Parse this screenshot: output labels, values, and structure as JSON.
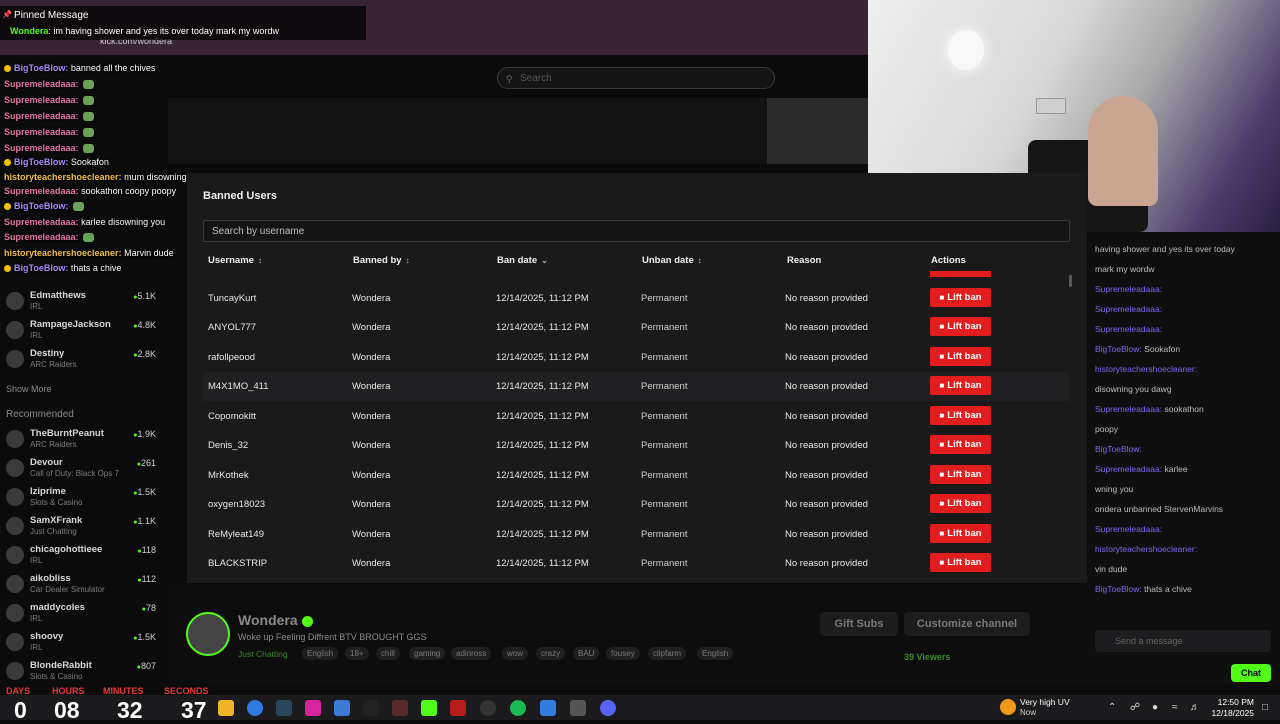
{
  "background": {
    "url": "kick.com/wondera",
    "search_placeholder": "Search"
  },
  "overlay_chat": {
    "pinned_title": "Pinned Message",
    "pinned_user": "Wondera",
    "pinned_text": "im having shower and yes its over today mark my wordw",
    "lines": [
      {
        "user": "BigToeBlow:",
        "text": "banned all the chives",
        "color": "#a78bfa",
        "badge": true
      },
      {
        "user": "Supremeleadaaa:",
        "text": "",
        "color": "#e879a6",
        "badge": false,
        "emote": true
      },
      {
        "user": "Supremeleadaaa:",
        "text": "",
        "color": "#e879a6",
        "badge": false,
        "emote": true
      },
      {
        "user": "Supremeleadaaa:",
        "text": "",
        "color": "#e879a6",
        "badge": false,
        "emote": true
      },
      {
        "user": "Supremeleadaaa:",
        "text": "",
        "color": "#e879a6",
        "badge": false,
        "emote": true
      },
      {
        "user": "Supremeleadaaa:",
        "text": "",
        "color": "#e879a6",
        "badge": false,
        "emote": true
      },
      {
        "user": "BigToeBlow:",
        "text": "Sookafon",
        "color": "#a78bfa",
        "badge": true
      },
      {
        "user": "historyteachershoecleaner:",
        "text": "mum disowning you dawg",
        "color": "#f0c040",
        "badge": false
      },
      {
        "user": "Supremeleadaaa:",
        "text": "sookathon coopy poopy",
        "color": "#e879a6",
        "badge": false
      },
      {
        "user": "BigToeBlow:",
        "text": "",
        "color": "#a78bfa",
        "badge": true,
        "emote": true
      },
      {
        "user": "Supremeleadaaa:",
        "text": "karlee disowning you",
        "color": "#e879a6",
        "badge": false
      },
      {
        "user": "Supremeleadaaa:",
        "text": "",
        "color": "#e879a6",
        "badge": false,
        "emote": true
      },
      {
        "user": "historyteachershoecleaner:",
        "text": "Marvin dude",
        "color": "#f0c040",
        "badge": false
      },
      {
        "user": "BigToeBlow:",
        "text": "thats a chive",
        "color": "#a78bfa",
        "badge": true
      }
    ]
  },
  "sidebar": {
    "recommended_label": "Recommended",
    "show_more": "Show More",
    "following": [
      {
        "name": "Edmatthews",
        "category": "IRL",
        "viewers": "5.1K"
      },
      {
        "name": "RampageJackson",
        "category": "IRL",
        "viewers": "4.8K"
      },
      {
        "name": "Destiny",
        "category": "ARC Raiders",
        "viewers": "2.8K"
      }
    ],
    "recommended": [
      {
        "name": "TheBurntPeanut",
        "category": "ARC Raiders",
        "viewers": "1.9K"
      },
      {
        "name": "Devour",
        "category": "Call of Duty: Black Ops 7",
        "viewers": "261"
      },
      {
        "name": "lziprime",
        "category": "Slots & Casino",
        "viewers": "1.5K"
      },
      {
        "name": "SamXFrank",
        "category": "Just Chatting",
        "viewers": "1.1K"
      },
      {
        "name": "chicagohottieee",
        "category": "IRL",
        "viewers": "118"
      },
      {
        "name": "aikobliss",
        "category": "Car Dealer Simulator",
        "viewers": "112"
      },
      {
        "name": "maddycoles",
        "category": "IRL",
        "viewers": "78"
      },
      {
        "name": "shoovy",
        "category": "IRL",
        "viewers": "1.5K"
      },
      {
        "name": "BlondeRabbit",
        "category": "Slots & Casino",
        "viewers": "807"
      }
    ]
  },
  "modal": {
    "title": "Banned Users",
    "search_placeholder": "Search by username",
    "columns": {
      "username": "Username",
      "banned_by": "Banned by",
      "ban_date": "Ban date",
      "unban_date": "Unban date",
      "reason": "Reason",
      "actions": "Actions"
    },
    "lift_label": "Lift ban",
    "rows": [
      {
        "username": "TuncayKurt",
        "banned_by": "Wondera",
        "ban_date": "12/14/2025, 11:12 PM",
        "unban_date": "Permanent",
        "reason": "No reason provided"
      },
      {
        "username": "ANYOL777",
        "banned_by": "Wondera",
        "ban_date": "12/14/2025, 11:12 PM",
        "unban_date": "Permanent",
        "reason": "No reason provided"
      },
      {
        "username": "rafollpeood",
        "banned_by": "Wondera",
        "ban_date": "12/14/2025, 11:12 PM",
        "unban_date": "Permanent",
        "reason": "No reason provided"
      },
      {
        "username": "M4X1MO_411",
        "banned_by": "Wondera",
        "ban_date": "12/14/2025, 11:12 PM",
        "unban_date": "Permanent",
        "reason": "No reason provided"
      },
      {
        "username": "Copomokitt",
        "banned_by": "Wondera",
        "ban_date": "12/14/2025, 11:12 PM",
        "unban_date": "Permanent",
        "reason": "No reason provided"
      },
      {
        "username": "Denis_32",
        "banned_by": "Wondera",
        "ban_date": "12/14/2025, 11:12 PM",
        "unban_date": "Permanent",
        "reason": "No reason provided"
      },
      {
        "username": "MrKothek",
        "banned_by": "Wondera",
        "ban_date": "12/14/2025, 11:12 PM",
        "unban_date": "Permanent",
        "reason": "No reason provided"
      },
      {
        "username": "oxygen18023",
        "banned_by": "Wondera",
        "ban_date": "12/14/2025, 11:12 PM",
        "unban_date": "Permanent",
        "reason": "No reason provided"
      },
      {
        "username": "ReMyleat149",
        "banned_by": "Wondera",
        "ban_date": "12/14/2025, 11:12 PM",
        "unban_date": "Permanent",
        "reason": "No reason provided"
      },
      {
        "username": "BLACKSTRIP",
        "banned_by": "Wondera",
        "ban_date": "12/14/2025, 11:12 PM",
        "unban_date": "Permanent",
        "reason": "No reason provided"
      }
    ]
  },
  "channel": {
    "name": "Wondera",
    "title": "Woke up Feeling Diffrent BTV BROUGHT GGS",
    "category": "Just Chatting",
    "tags": [
      "English",
      "18+",
      "chill",
      "gaming",
      "adinross",
      "wow",
      "crazy",
      "BAU",
      "fousey",
      "clipfarm",
      "English"
    ],
    "gift_label": "Gift Subs",
    "customize_label": "Customize channel",
    "viewers": "39 Viewers"
  },
  "right_chat": {
    "lines": [
      {
        "user": "",
        "text": "having shower and yes its over today"
      },
      {
        "user": "",
        "text": "mark my wordw"
      },
      {
        "user": "Supremeleadaaa:",
        "text": ""
      },
      {
        "user": "Supremeleadaaa:",
        "text": ""
      },
      {
        "user": "Supremeleadaaa:",
        "text": ""
      },
      {
        "user": "BigToeBlow:",
        "text": "Sookafon"
      },
      {
        "user": "historyteachershoecleaner:",
        "text": ""
      },
      {
        "user": "",
        "text": "disowning you dawg"
      },
      {
        "user": "Supremeleadaaa:",
        "text": "sookathon"
      },
      {
        "user": "",
        "text": "poopy"
      },
      {
        "user": "BigToeBlow:",
        "text": ""
      },
      {
        "user": "Supremeleadaaa:",
        "text": "karlee"
      },
      {
        "user": "",
        "text": "wning you"
      },
      {
        "user": "",
        "text": "ondera unbanned StervenMarvins"
      },
      {
        "user": "Supremeleadaaa:",
        "text": ""
      },
      {
        "user": "historyteachershoecleaner:",
        "text": ""
      },
      {
        "user": "",
        "text": "vin dude"
      },
      {
        "user": "BigToeBlow:",
        "text": "thats a chive"
      }
    ],
    "send_placeholder": "Send a message",
    "chat_button": "Chat"
  },
  "taskbar": {
    "countdown_labels": [
      "DAYS",
      "HOURS",
      "MINUTES",
      "SECONDS"
    ],
    "countdown_values": [
      "0",
      "08",
      "32",
      "37"
    ],
    "weather_title": "Very high UV",
    "weather_sub": "Now",
    "time": "12:50 PM",
    "date": "12/18/2025"
  }
}
